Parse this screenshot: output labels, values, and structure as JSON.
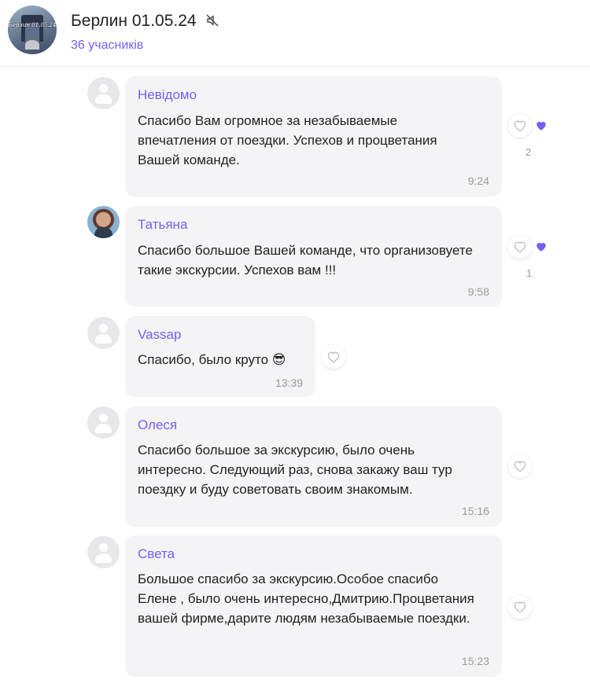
{
  "chat": {
    "title": "Берлин 01.05.24",
    "members": "36 учасників",
    "avatar_text": "Берлин 01.05.24"
  },
  "messages": [
    {
      "sender": "Невідомо",
      "text": "Спасибо Вам огромное за незабываемые впечатления от поездки. Успехов и процветания Вашей команде.",
      "time": "9:24",
      "likes": "2"
    },
    {
      "sender": "Татьяна",
      "text": "Спасибо большое Вашей команде, что организовуете такие экскурсии. Успехов вам !!!",
      "time": "9:58",
      "likes": "1"
    },
    {
      "sender": "Vassap",
      "text": "Спасибо, было круто 😎",
      "time": "13:39"
    },
    {
      "sender": "Олеся",
      "text": "Спасибо большое за экскурсию, было очень интересно. Следующий раз, снова закажу ваш тур поездку и буду советовать своим знакомым.",
      "time": "15:16"
    },
    {
      "sender": "Света",
      "text": "Большое спасибо за экскурсию.Особое спасибо Елене , было очень интересно,Дмитрию.Процветания вашей фирме,дарите людям незабываемые поездки.",
      "time": "15:23"
    }
  ],
  "colors": {
    "accent": "#7360f2",
    "bubble": "#f4f4f6"
  },
  "icons": [
    "mute-icon",
    "heart-outline-icon",
    "purple-heart-icon",
    "default-avatar-icon"
  ]
}
